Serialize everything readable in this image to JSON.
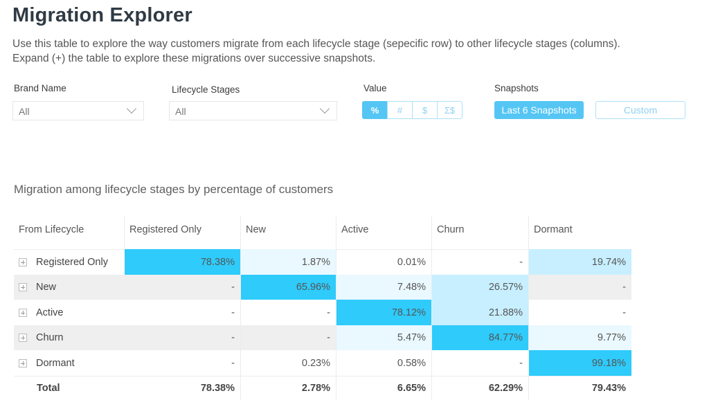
{
  "header": {
    "title": "Migration Explorer",
    "description_line1": "Use this table to explore the way customers migrate from each lifecycle stage (sepecific row) to other lifecycle stages (columns).",
    "description_line2": "Expand (+) the table to explore these migrations over successive snapshots."
  },
  "filters": {
    "brand_name": {
      "label": "Brand Name",
      "value": "All"
    },
    "lifecycle_stages": {
      "label": "Lifecycle Stages",
      "value": "All"
    },
    "value": {
      "label": "Value",
      "options": [
        "%",
        "#",
        "$",
        "Σ$"
      ],
      "selected": "%"
    },
    "snapshots": {
      "label": "Snapshots",
      "options": [
        "Last 6 Snapshots",
        "Custom"
      ],
      "selected": "Last 6 Snapshots"
    }
  },
  "colors": {
    "accent": "#55c6f4",
    "accent_light_border": "#aee0f8",
    "heat_strong": "#2ecbfb",
    "heat_medium": "#c7efff",
    "heat_light": "#eaf8ff",
    "row_alt": "#efefef"
  },
  "table": {
    "title": "Migration among lifecycle stages by percentage of customers",
    "columns": [
      "From Lifecycle",
      "Registered Only",
      "New",
      "Active",
      "Churn",
      "Dormant"
    ],
    "rows": [
      {
        "label": "Registered Only",
        "values": [
          "78.38%",
          "1.87%",
          "0.01%",
          "-",
          "19.74%"
        ],
        "heat": [
          "strong",
          "light",
          "none",
          "none",
          "medium"
        ]
      },
      {
        "label": "New",
        "values": [
          "-",
          "65.96%",
          "7.48%",
          "26.57%",
          "-"
        ],
        "heat": [
          "none",
          "strong",
          "light",
          "medium",
          "none"
        ]
      },
      {
        "label": "Active",
        "values": [
          "-",
          "-",
          "78.12%",
          "21.88%",
          "-"
        ],
        "heat": [
          "none",
          "none",
          "strong",
          "medium",
          "none"
        ]
      },
      {
        "label": "Churn",
        "values": [
          "-",
          "-",
          "5.47%",
          "84.77%",
          "9.77%"
        ],
        "heat": [
          "none",
          "none",
          "light",
          "strong",
          "light"
        ]
      },
      {
        "label": "Dormant",
        "values": [
          "-",
          "0.23%",
          "0.58%",
          "-",
          "99.18%"
        ],
        "heat": [
          "none",
          "none",
          "none",
          "none",
          "strong"
        ]
      }
    ],
    "total": {
      "label": "Total",
      "values": [
        "78.38%",
        "2.78%",
        "6.65%",
        "62.29%",
        "79.43%"
      ]
    }
  }
}
